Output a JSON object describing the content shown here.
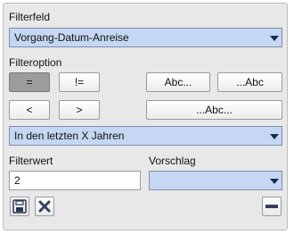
{
  "filterfeld": {
    "label": "Filterfeld",
    "selected": "Vorgang-Datum-Anreise"
  },
  "filteroption": {
    "label": "Filteroption",
    "buttons": {
      "equals": "=",
      "not_equals": "!=",
      "less": "<",
      "greater": ">",
      "starts_with": "Abc...",
      "ends_with": "...Abc",
      "contains": "...Abc..."
    },
    "selected_range": "In den letzten X Jahren"
  },
  "filterwert": {
    "label": "Filterwert",
    "value": "2"
  },
  "vorschlag": {
    "label": "Vorschlag",
    "selected": ""
  },
  "colors": {
    "combo_bg": "#c5d7f2",
    "pressed_button": "#9c9c9c",
    "panel_bg": "#e8e8e8"
  },
  "icons": [
    "save-icon",
    "delete-icon",
    "remove-icon"
  ]
}
